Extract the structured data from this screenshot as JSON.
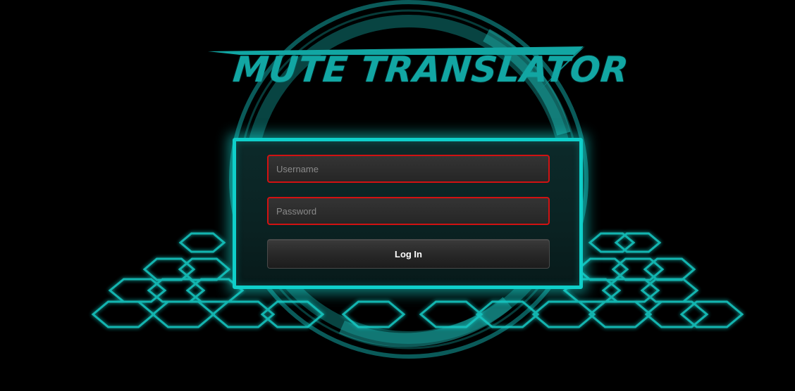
{
  "app": {
    "title": "MUTE TRANSLATOR"
  },
  "login_form": {
    "username_placeholder": "Username",
    "username_value": "",
    "password_placeholder": "Password",
    "password_value": "",
    "submit_label": "Log In"
  },
  "colors": {
    "accent_cyan": "#0fcfca",
    "logo_teal": "#12a6a3",
    "invalid_border": "#d11212",
    "background": "#000000"
  }
}
